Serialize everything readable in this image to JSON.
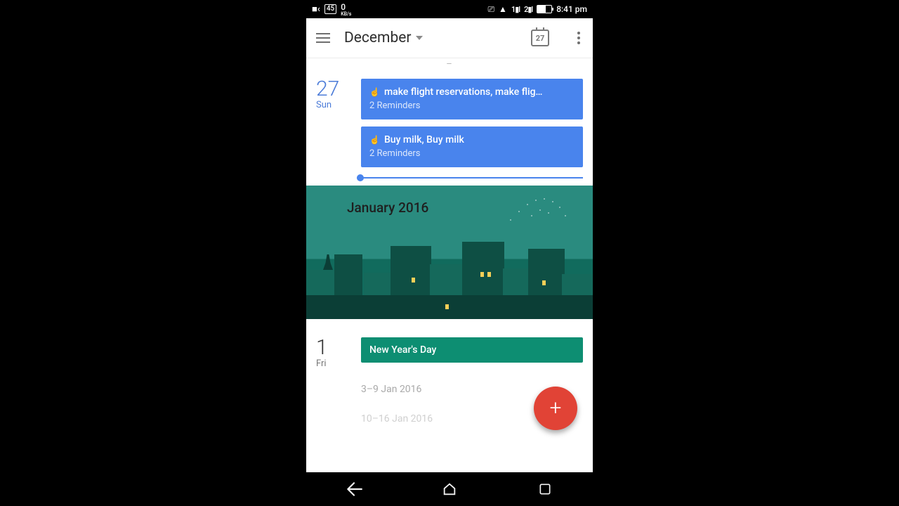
{
  "status": {
    "battery_badge": "45",
    "net_speed_value": "0",
    "net_speed_unit": "KB/s",
    "signal1": "1",
    "signal2": "2",
    "time": "8:41 pm"
  },
  "header": {
    "month": "December",
    "today_number": "27"
  },
  "agenda": {
    "truncated_range_hint": "–",
    "dec27": {
      "daynum": "27",
      "dayname": "Sun",
      "reminders": [
        {
          "title": "make flight reservations, make flig…",
          "subtitle": "2 Reminders"
        },
        {
          "title": "Buy milk, Buy milk",
          "subtitle": "2 Reminders"
        }
      ]
    },
    "month_hero_label": "January 2016",
    "jan1": {
      "daynum": "1",
      "dayname": "Fri",
      "event_title": "New Year's Day",
      "week_range_1": "3–9 Jan 2016",
      "week_range_2": "10–16 Jan 2016"
    }
  },
  "fab": {
    "glyph": "+"
  }
}
